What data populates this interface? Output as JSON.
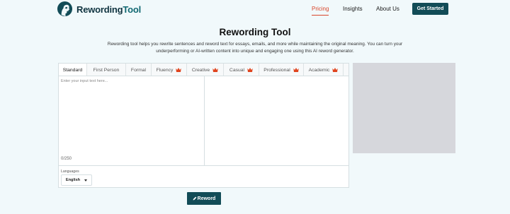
{
  "brand": {
    "name_part1": "Rewording",
    "name_part2": "Tool",
    "logo_icon": "head-silhouette-icon"
  },
  "nav": {
    "items": [
      {
        "label": "Pricing",
        "active": true
      },
      {
        "label": "Insights",
        "active": false
      },
      {
        "label": "About Us",
        "active": false
      }
    ],
    "cta_label": "Get Started"
  },
  "hero": {
    "title": "Rewording Tool",
    "description": "Rewording tool helps you rewrite sentences and reword text for essays, emails, and more while maintaining the original meaning. You can turn your underperforming or AI-written content into unique and engaging one using this AI reword generator."
  },
  "editor": {
    "tabs": [
      {
        "label": "Standard",
        "active": true,
        "premium": false
      },
      {
        "label": "First Person",
        "active": false,
        "premium": false
      },
      {
        "label": "Formal",
        "active": false,
        "premium": false
      },
      {
        "label": "Fluency",
        "active": false,
        "premium": true
      },
      {
        "label": "Creative",
        "active": false,
        "premium": true
      },
      {
        "label": "Casual",
        "active": false,
        "premium": true
      },
      {
        "label": "Professional",
        "active": false,
        "premium": true
      },
      {
        "label": "Academic",
        "active": false,
        "premium": true
      }
    ],
    "input_placeholder": "Enter your input text here...",
    "input_value": "",
    "counter": "0/250",
    "languages_label": "Languages",
    "language_selected": "English"
  },
  "reword_button_label": "Reword",
  "colors": {
    "primary": "#124c57",
    "accent": "#d9452a",
    "background": "#f1f9fb",
    "premium_crown": "#e0451f"
  }
}
